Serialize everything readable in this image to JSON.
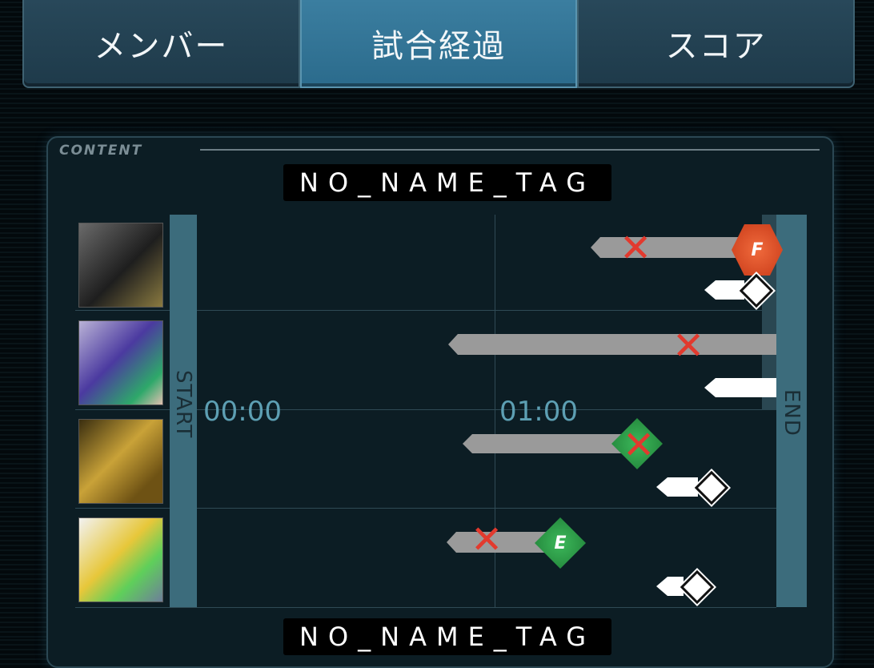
{
  "tabs": [
    {
      "label": "メンバー",
      "active": false
    },
    {
      "label": "試合経過",
      "active": true
    },
    {
      "label": "スコア",
      "active": false
    }
  ],
  "panel": {
    "label": "CONTENT",
    "team_top": "NO_NAME_TAG",
    "team_bottom": "NO_NAME_TAG"
  },
  "timeline": {
    "start_label": "START",
    "end_label": "END",
    "time_labels": [
      "00:00",
      "01:00"
    ],
    "icons": {
      "portrait": "unit-portrait",
      "defeat": "defeat-x-icon",
      "red_badge": "red-f-badge-icon",
      "green_badge": "green-e-badge-icon",
      "white_marker": "white-diamond-marker-icon"
    },
    "badge_letters": {
      "red": "F",
      "green": "E"
    }
  },
  "colors": {
    "tab_active": "#2b6b8c",
    "tab_inactive": "#1e3a4a",
    "defeat": "#e23a2e",
    "bar_gray": "#9a9a9a",
    "start_end_bar": "#3c6c7c",
    "time_label": "#5d9fb3"
  }
}
